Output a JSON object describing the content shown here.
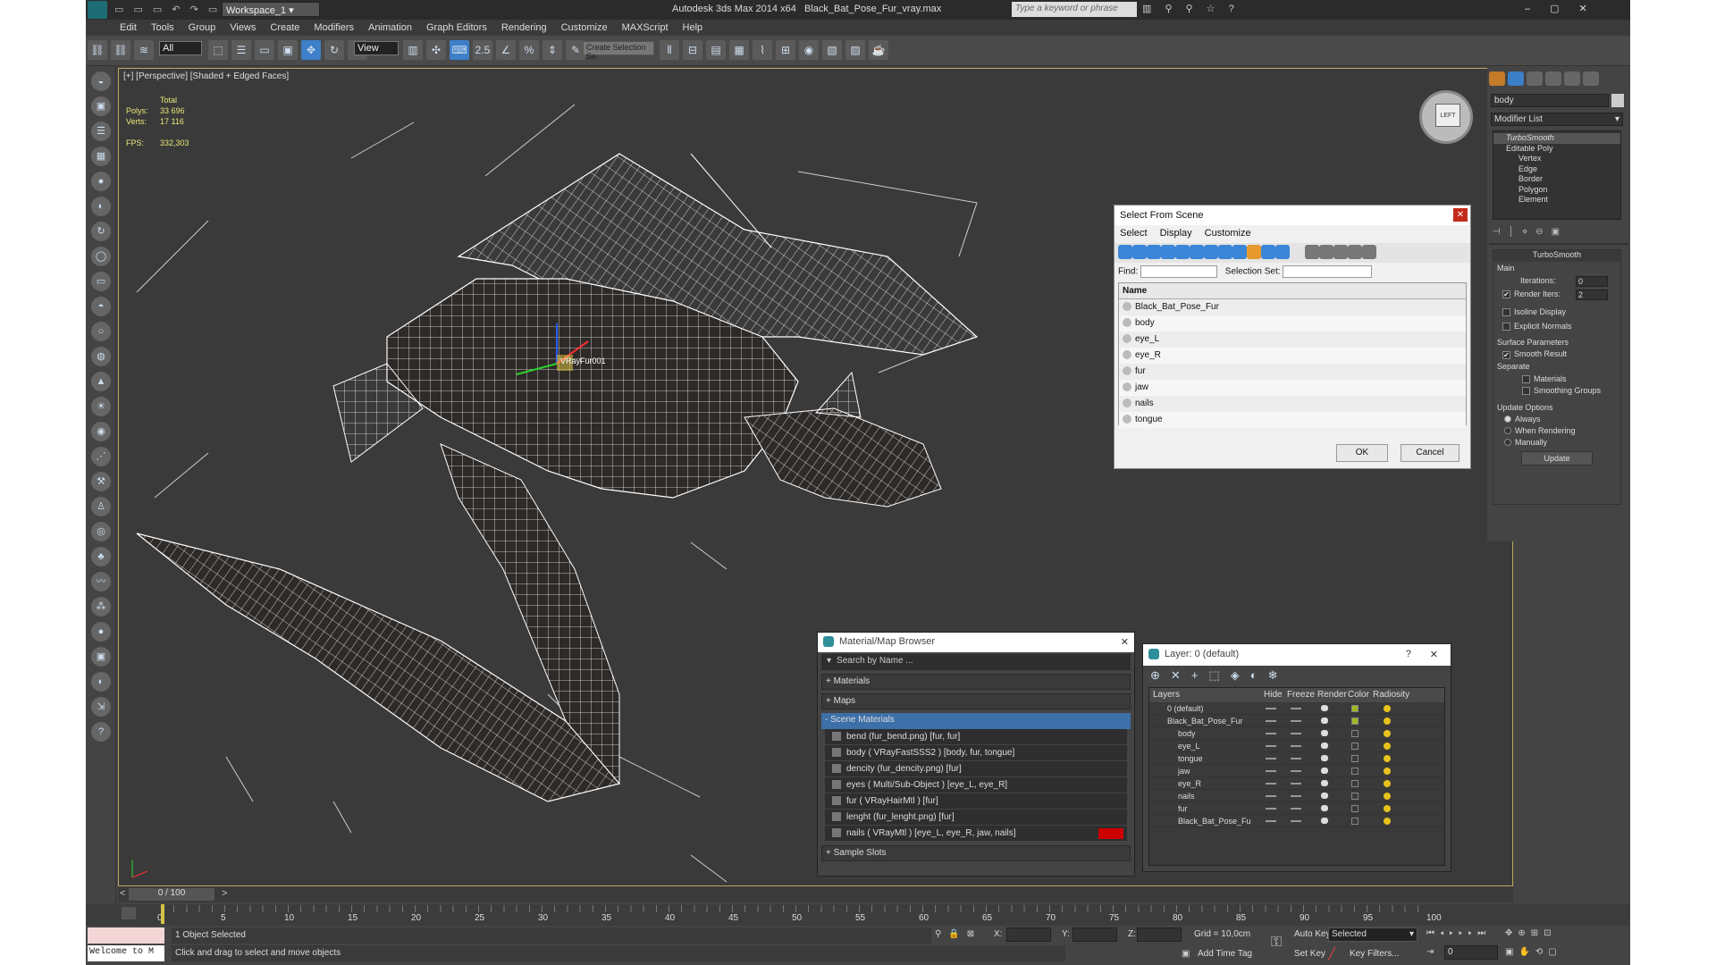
{
  "titlebar": {
    "workspace": "Workspace_1",
    "app_title": "Autodesk 3ds Max  2014 x64",
    "file_title": "Black_Bat_Pose_Fur_vray.max",
    "search_placeholder": "Type a keyword or phrase"
  },
  "menu": [
    "Edit",
    "Tools",
    "Group",
    "Views",
    "Create",
    "Modifiers",
    "Animation",
    "Graph Editors",
    "Rendering",
    "Customize",
    "MAXScript",
    "Help"
  ],
  "toolbar": {
    "filter": "All",
    "refcoord": "View",
    "selset": "Create Selection Se"
  },
  "viewport": {
    "label": "[+] [Perspective] [Shaded + Edged Faces]",
    "stats": {
      "total": "Total",
      "polys_label": "Polys:",
      "polys": "33 696",
      "verts_label": "Verts:",
      "verts": "17 116",
      "fps_label": "FPS:",
      "fps": "332,303"
    },
    "gizmo_label": "VRayFur001",
    "viewcube": "LEFT"
  },
  "cmdpanel": {
    "object_name": "body",
    "modifier_list": "Modifier List",
    "stack": [
      "TurboSmooth",
      "Editable Poly",
      "Vertex",
      "Edge",
      "Border",
      "Polygon",
      "Element"
    ],
    "rollout": "TurboSmooth",
    "main": "Main",
    "iterations_label": "Iterations:",
    "iterations": "0",
    "render_iters_label": "Render Iters:",
    "render_iters": "2",
    "isoline": "Isoline Display",
    "explicit": "Explicit Normals",
    "surface": "Surface Parameters",
    "smooth_result": "Smooth Result",
    "separate": "Separate",
    "materials": "Materials",
    "smoothing_groups": "Smoothing Groups",
    "update_options": "Update Options",
    "always": "Always",
    "when_rendering": "When Rendering",
    "manually": "Manually",
    "update_btn": "Update"
  },
  "select_dialog": {
    "title": "Select From Scene",
    "menus": [
      "Select",
      "Display",
      "Customize"
    ],
    "find": "Find:",
    "selection_set": "Selection Set:",
    "header": "Name",
    "items": [
      "Black_Bat_Pose_Fur",
      "body",
      "eye_L",
      "eye_R",
      "fur",
      "jaw",
      "nails",
      "tongue"
    ],
    "ok": "OK",
    "cancel": "Cancel"
  },
  "material_browser": {
    "title": "Material/Map Browser",
    "search": "Search by Name ...",
    "groups": [
      "+ Materials",
      "+ Maps",
      "- Scene Materials"
    ],
    "items": [
      "bend (fur_bend.png)  [fur, fur]",
      "body  ( VRayFastSSS2 )  [body, fur, tongue]",
      "dencity (fur_dencity.png)  [fur]",
      "eyes  ( Multi/Sub-Object )  [eye_L, eye_R]",
      "fur  ( VRayHairMtl )  [fur]",
      "lenght (fur_lenght.png)  [fur]",
      "nails  ( VRayMtl )  [eye_L, eye_R, jaw, nails]"
    ],
    "sample_slots": "+ Sample Slots"
  },
  "layer_dialog": {
    "title": "Layer: 0 (default)",
    "help": "?",
    "cols": [
      "Layers",
      "Hide",
      "Freeze",
      "Render",
      "Color",
      "Radiosity"
    ],
    "rows": [
      "0 (default)",
      "Black_Bat_Pose_Fur",
      "body",
      "eye_L",
      "tongue",
      "jaw",
      "eye_R",
      "nails",
      "fur",
      "Black_Bat_Pose_Fu"
    ]
  },
  "timeline": {
    "frame": "0 / 100",
    "ticks": [
      "0",
      "5",
      "10",
      "15",
      "20",
      "25",
      "30",
      "35",
      "40",
      "45",
      "50",
      "55",
      "60",
      "65",
      "70",
      "75",
      "80",
      "85",
      "90",
      "95",
      "100"
    ]
  },
  "status": {
    "welcome": "Welcome to M",
    "selected": "1 Object Selected",
    "hint": "Click and drag to select and move objects",
    "x": "X:",
    "y": "Y:",
    "z": "Z:",
    "grid": "Grid = 10,0cm",
    "add_time_tag": "Add Time Tag",
    "auto_key": "Auto Key",
    "selected_dd": "Selected",
    "set_key": "Set Key",
    "key_filters": "Key Filters...",
    "frame_field": "0"
  }
}
